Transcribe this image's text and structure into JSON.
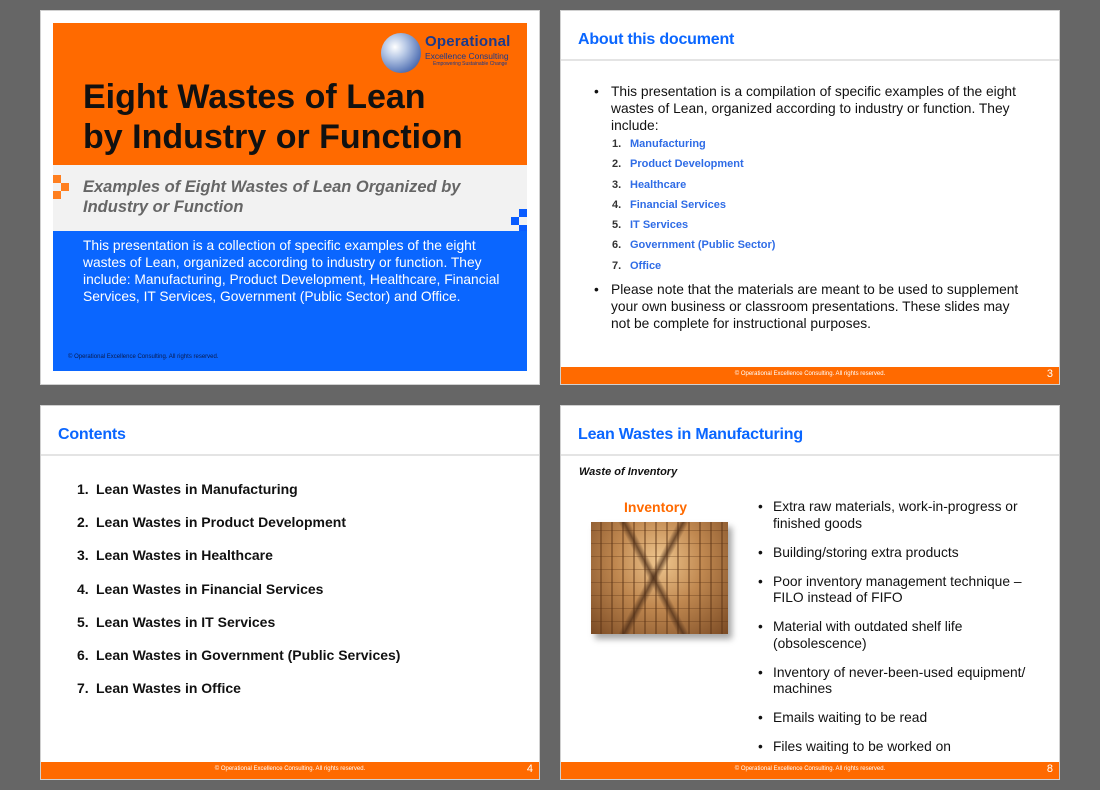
{
  "brand": {
    "orange": "#ff6a00",
    "blue": "#0a66ff",
    "logo_name": "Operational",
    "logo_sub": "Excellence Consulting",
    "logo_tagline": "Empowering Sustainable Change"
  },
  "slide1": {
    "title_line1": "Eight Wastes of Lean",
    "title_line2": "by Industry or Function",
    "subtitle": "Examples of Eight Wastes of Lean Organized by Industry or Function",
    "description": "This presentation is a collection of specific examples of the eight wastes of Lean, organized according to industry or function. They include: Manufacturing, Product Development, Healthcare, Financial Services, IT Services, Government (Public Sector) and Office.",
    "copyright": "© Operational Excellence Consulting.  All rights reserved."
  },
  "slide3": {
    "title": "About this document",
    "bullet1": "This presentation is a compilation of specific examples of the eight wastes of Lean, organized according to industry or function. They include:",
    "list": [
      {
        "num": "1.",
        "label": "Manufacturing"
      },
      {
        "num": "2.",
        "label": "Product Development"
      },
      {
        "num": "3.",
        "label": "Healthcare"
      },
      {
        "num": "4.",
        "label": "Financial Services"
      },
      {
        "num": "5.",
        "label": "IT Services"
      },
      {
        "num": "6.",
        "label": "Government (Public Sector)"
      },
      {
        "num": "7.",
        "label": "Office"
      }
    ],
    "bullet2": "Please note that the materials are meant to be used to supplement your own business or classroom presentations. These slides may not be complete for instructional purposes.",
    "copyright": "© Operational Excellence Consulting.  All rights reserved.",
    "page": "3"
  },
  "slide4": {
    "title": "Contents",
    "items": [
      {
        "num": "1.",
        "label": "Lean Wastes in Manufacturing"
      },
      {
        "num": "2.",
        "label": "Lean Wastes in Product Development"
      },
      {
        "num": "3.",
        "label": "Lean Wastes in Healthcare"
      },
      {
        "num": "4.",
        "label": "Lean Wastes in Financial Services"
      },
      {
        "num": "5.",
        "label": "Lean Wastes in IT Services"
      },
      {
        "num": "6.",
        "label": "Lean Wastes in Government (Public Services)"
      },
      {
        "num": "7.",
        "label": "Lean Wastes in Office"
      }
    ],
    "copyright": "© Operational Excellence Consulting.  All rights reserved.",
    "page": "4"
  },
  "slide8": {
    "title": "Lean Wastes in Manufacturing",
    "subheading": "Waste of Inventory",
    "image_label": "Inventory",
    "image_alt": "warehouse-shelves-photo",
    "bullets": [
      "Extra raw materials, work-in-progress or finished goods",
      "Building/storing extra products",
      "Poor inventory management technique – FILO instead of FIFO",
      "Material with outdated shelf life (obsolescence)",
      "Inventory of never-been-used equipment/ machines",
      "Emails waiting to be read",
      "Files waiting to be worked on"
    ],
    "copyright": "© Operational Excellence Consulting.  All rights reserved.",
    "page": "8"
  },
  "bullet_glyph": "•"
}
